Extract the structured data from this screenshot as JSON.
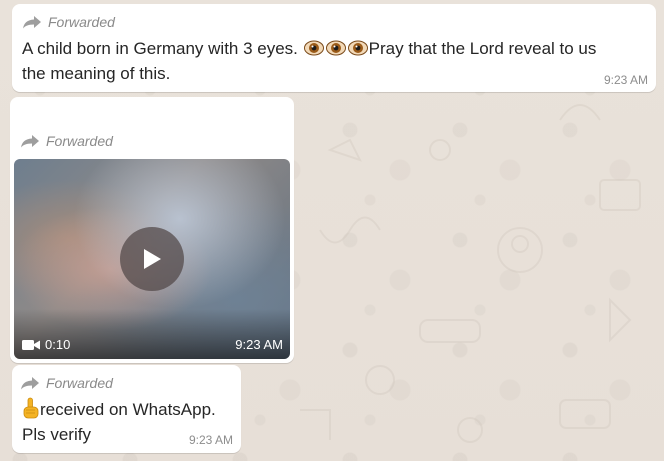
{
  "messages": [
    {
      "forwarded_label": "Forwarded",
      "text_line1_before_emoji": "A child born in Germany with 3 eyes. ",
      "text_line1_after_emoji": "Pray that the Lord reveal to us",
      "text_line2": "the meaning of this.",
      "emoji": "eye",
      "time": "9:23 AM"
    },
    {
      "forwarded_label": "Forwarded",
      "media_type": "video",
      "duration": "0:10",
      "time": "9:23 AM"
    },
    {
      "forwarded_label": "Forwarded",
      "emoji": "index-pointing-up",
      "text_line1": "received on WhatsApp.",
      "text_line2": "Pls verify",
      "time": "9:23 AM"
    }
  ],
  "colors": {
    "chat_background": "#e5ddd5",
    "bubble": "#ffffff",
    "meta_text": "#8d8d8d"
  },
  "icons": [
    "forward-arrow-icon",
    "play-icon",
    "video-camera-icon",
    "eye-emoji",
    "pointing-up-emoji"
  ]
}
